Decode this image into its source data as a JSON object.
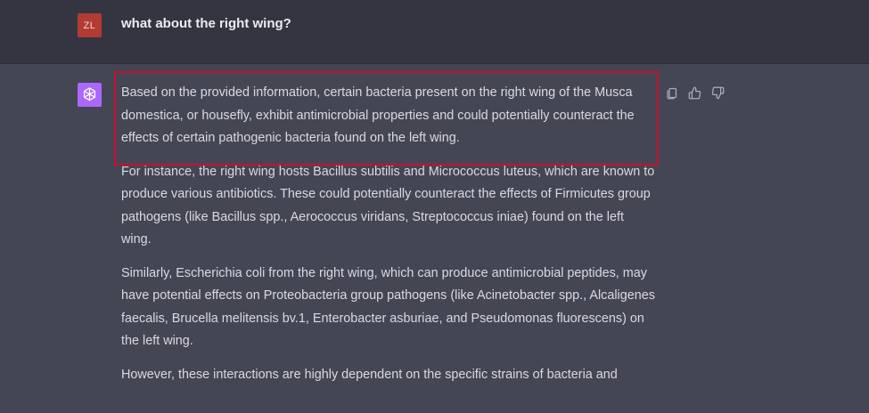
{
  "user_message": {
    "avatar_initials": "ZL",
    "text": "what about the right wing?"
  },
  "assistant_message": {
    "paragraphs": [
      "Based on the provided information, certain bacteria present on the right wing of the Musca domestica, or housefly, exhibit antimicrobial properties and could potentially counteract the effects of certain pathogenic bacteria found on the left wing.",
      "For instance, the right wing hosts Bacillus subtilis and Micrococcus luteus, which are known to produce various antibiotics. These could potentially counteract the effects of Firmicutes group pathogens (like Bacillus spp., Aerococcus viridans, Streptococcus iniae) found on the left wing.",
      "Similarly, Escherichia coli from the right wing, which can produce antimicrobial peptides, may have potential effects on Proteobacteria group pathogens (like Acinetobacter spp., Alcaligenes faecalis, Brucella melitensis bv.1, Enterobacter asburiae, and Pseudomonas fluorescens) on the left wing.",
      "However, these interactions are highly dependent on the specific strains of bacteria and"
    ]
  },
  "actions": {
    "copy_icon": "copy-icon",
    "thumbs_up_icon": "thumbs-up-icon",
    "thumbs_down_icon": "thumbs-down-icon"
  },
  "colors": {
    "user_bg": "#343541",
    "assistant_bg": "#444654",
    "user_avatar": "#b23b33",
    "bot_avatar": "#ab68ff",
    "highlight": "#c8102e"
  }
}
